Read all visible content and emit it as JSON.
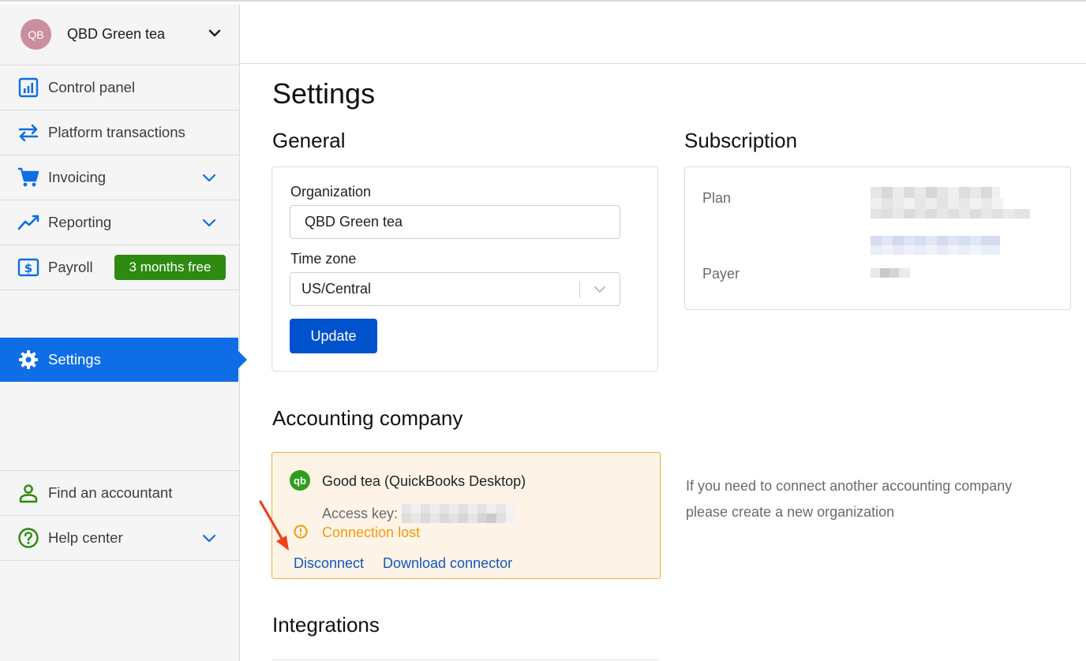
{
  "org": {
    "avatar_initials": "QB",
    "name": "QBD Green tea"
  },
  "sidebar": {
    "items": [
      {
        "label": "Control panel",
        "icon": "bar-chart-icon"
      },
      {
        "label": "Platform transactions",
        "icon": "swap-arrows-icon"
      },
      {
        "label": "Invoicing",
        "icon": "cart-icon",
        "expandable": true
      },
      {
        "label": "Reporting",
        "icon": "trend-line-icon",
        "expandable": true
      },
      {
        "label": "Payroll",
        "icon": "dollar-icon",
        "badge": "3 months free"
      }
    ],
    "active": {
      "label": "Settings",
      "icon": "gear-icon"
    },
    "bottom": [
      {
        "label": "Find an accountant",
        "icon": "person-icon"
      },
      {
        "label": "Help center",
        "icon": "help-icon",
        "expandable": true
      }
    ]
  },
  "page": {
    "title": "Settings"
  },
  "general": {
    "title": "General",
    "org_label": "Organization",
    "org_value": "QBD Green tea",
    "tz_label": "Time zone",
    "tz_value": "US/Central",
    "update_label": "Update"
  },
  "subscription": {
    "title": "Subscription",
    "plan_label": "Plan",
    "payer_label": "Payer"
  },
  "accounting": {
    "title": "Accounting company",
    "company": "Good tea (QuickBooks Desktop)",
    "access_key_label": "Access key:",
    "status": "Connection lost",
    "disconnect": "Disconnect",
    "download": "Download connector",
    "note": "If you need to connect another accounting company please create a new organization"
  },
  "integrations": {
    "title": "Integrations"
  },
  "colors": {
    "accent": "#0f6ee6",
    "button": "#0052cc",
    "badge": "#2e8a10",
    "warning": "#f39a0c",
    "link": "#1456c2",
    "annotation_arrow": "#f0401a"
  }
}
